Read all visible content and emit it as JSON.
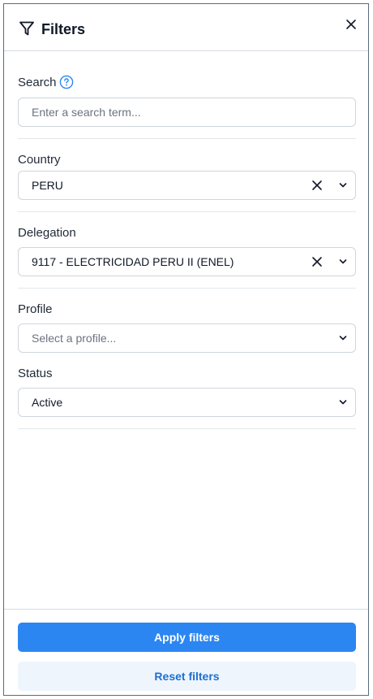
{
  "header": {
    "title": "Filters",
    "icon": "funnel-icon",
    "close_icon": "close-icon"
  },
  "search": {
    "label": "Search",
    "placeholder": "Enter a search term..."
  },
  "country": {
    "label": "Country",
    "value": "PERU"
  },
  "delegation": {
    "label": "Delegation",
    "value": "9117 - ELECTRICIDAD PERU II (ENEL)"
  },
  "profile": {
    "label": "Profile",
    "placeholder": "Select a profile..."
  },
  "status": {
    "label": "Status",
    "value": "Active"
  },
  "footer": {
    "apply_label": "Apply filters",
    "reset_label": "Reset filters"
  },
  "colors": {
    "accent": "#2b86f2",
    "reset_bg": "#eef5fd",
    "reset_text": "#1f6fd0"
  }
}
